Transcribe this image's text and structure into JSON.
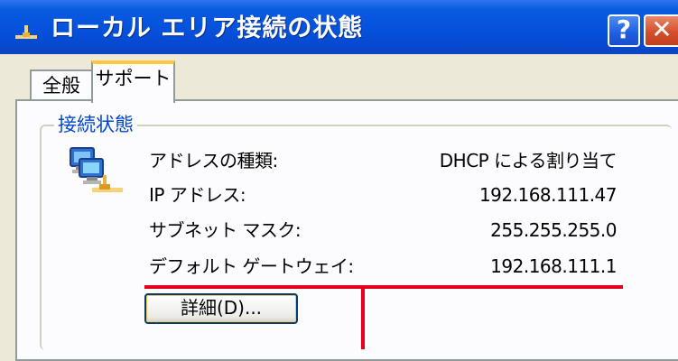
{
  "window": {
    "title": "ローカル エリア接続の状態",
    "help_button": "?",
    "close_button": "✕"
  },
  "tabs": [
    {
      "label": "全般",
      "selected": false
    },
    {
      "label": "サポート",
      "selected": true
    }
  ],
  "group": {
    "title": "接続状態",
    "icon": "network-connection-icon",
    "rows": [
      {
        "label": "アドレスの種類:",
        "value": "DHCP による割り当て"
      },
      {
        "label": "IP アドレス:",
        "value": "192.168.111.47"
      },
      {
        "label": "サブネット マスク:",
        "value": "255.255.255.0"
      },
      {
        "label": "デフォルト ゲートウェイ:",
        "value": "192.168.111.1"
      }
    ]
  },
  "details_button": "詳細(D)...",
  "colors": {
    "titlebar": "#0551dc",
    "group_title": "#0046d5",
    "annotation": "#e2001a",
    "tab_highlight": "#ffc83c"
  }
}
